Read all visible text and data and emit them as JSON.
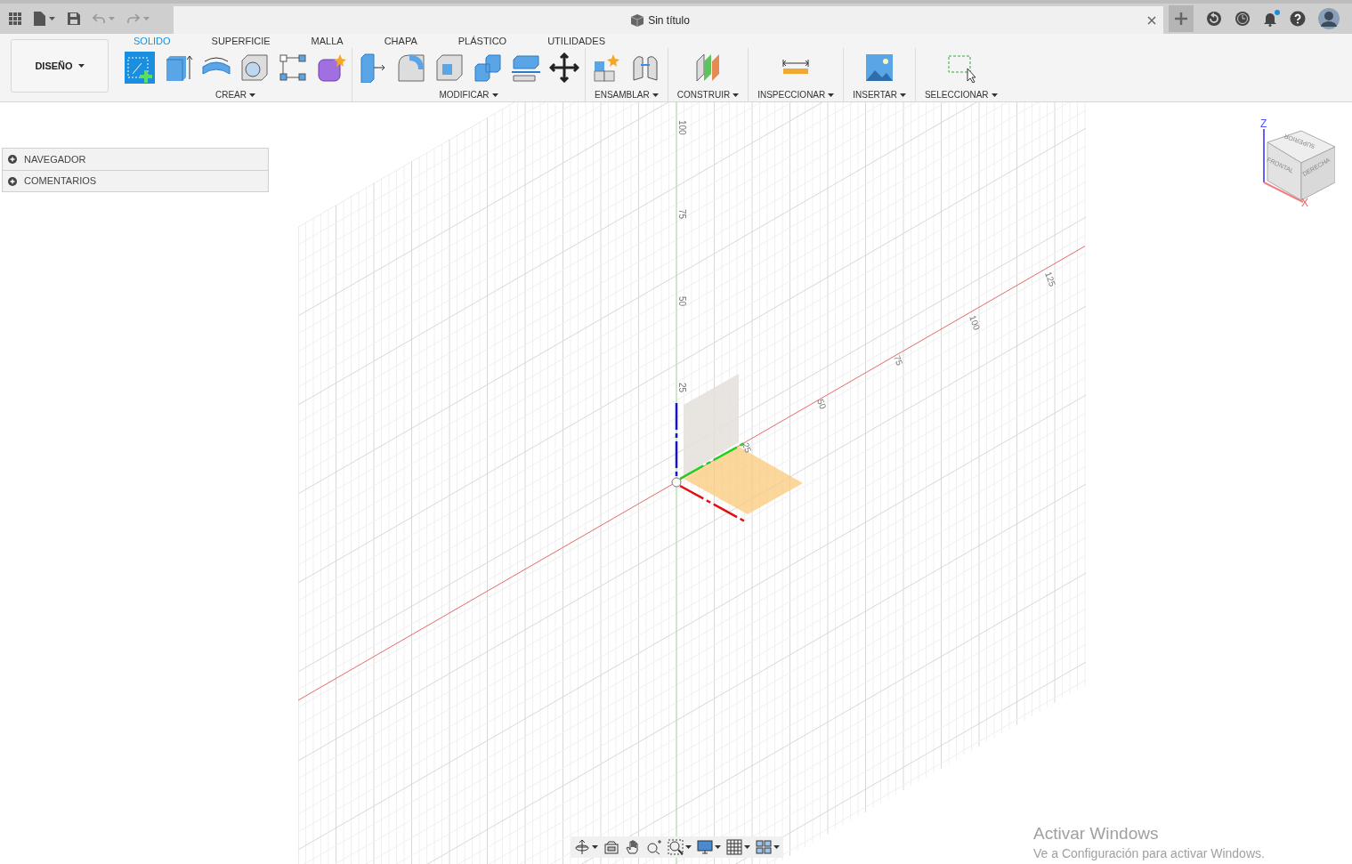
{
  "top_bar": {
    "document_title": "Sin título",
    "notifications_unread": true
  },
  "ribbon": {
    "workspace": "DISEÑO",
    "tabs": [
      {
        "label": "SOLIDO",
        "selected": true
      },
      {
        "label": "SUPERFICIE",
        "selected": false
      },
      {
        "label": "MALLA",
        "selected": false
      },
      {
        "label": "CHAPA",
        "selected": false
      },
      {
        "label": "PLÁSTICO",
        "selected": false
      },
      {
        "label": "UTILIDADES",
        "selected": false
      }
    ],
    "groups": [
      {
        "label": "CREAR",
        "tools": [
          {
            "kind": "sketch",
            "selected": true
          },
          {
            "kind": "extrude",
            "selected": false
          },
          {
            "kind": "revolve",
            "selected": false
          },
          {
            "kind": "hole",
            "selected": false
          },
          {
            "kind": "pattern",
            "selected": false
          },
          {
            "kind": "form",
            "selected": false
          }
        ]
      },
      {
        "label": "MODIFICAR",
        "tools": [
          {
            "kind": "pushpull",
            "selected": false
          },
          {
            "kind": "fillet",
            "selected": false
          },
          {
            "kind": "shell",
            "selected": false
          },
          {
            "kind": "combine",
            "selected": false
          },
          {
            "kind": "split",
            "selected": false
          },
          {
            "kind": "move",
            "selected": false
          }
        ]
      },
      {
        "label": "ENSAMBLAR",
        "tools": [
          {
            "kind": "component",
            "selected": false
          },
          {
            "kind": "joint",
            "selected": false
          }
        ]
      },
      {
        "label": "CONSTRUIR",
        "tools": [
          {
            "kind": "plane",
            "selected": false
          }
        ]
      },
      {
        "label": "INSPECCIONAR",
        "tools": [
          {
            "kind": "measure",
            "selected": false
          }
        ]
      },
      {
        "label": "INSERTAR",
        "tools": [
          {
            "kind": "image",
            "selected": false
          }
        ]
      },
      {
        "label": "SELECCIONAR",
        "tools": [
          {
            "kind": "select",
            "selected": false
          }
        ]
      }
    ]
  },
  "browser": [
    {
      "label": "NAVEGADOR",
      "expanded": false
    },
    {
      "label": "COMENTARIOS",
      "expanded": false
    }
  ],
  "viewport": {
    "vertical_axis_labels": [
      "100",
      "75",
      "50",
      "25"
    ],
    "horizontal_axis_labels": [
      "25",
      "50",
      "75",
      "100",
      "125"
    ]
  },
  "view_cube": {
    "top": "SUPERIOR",
    "front": "FRONTAL",
    "right": "DERECHA",
    "z_label": "Z",
    "x_label": "X"
  },
  "nav_bar": [
    {
      "kind": "orbit",
      "menu": true
    },
    {
      "kind": "look-at",
      "menu": false
    },
    {
      "kind": "pan",
      "menu": false
    },
    {
      "kind": "zoom",
      "menu": false
    },
    {
      "kind": "fit",
      "menu": true
    },
    {
      "kind": "display",
      "menu": true
    },
    {
      "kind": "grid",
      "menu": true
    },
    {
      "kind": "viewports",
      "menu": true
    }
  ],
  "os_notice": {
    "title": "Activar Windows",
    "text": "Ve a Configuración para activar Windows."
  }
}
